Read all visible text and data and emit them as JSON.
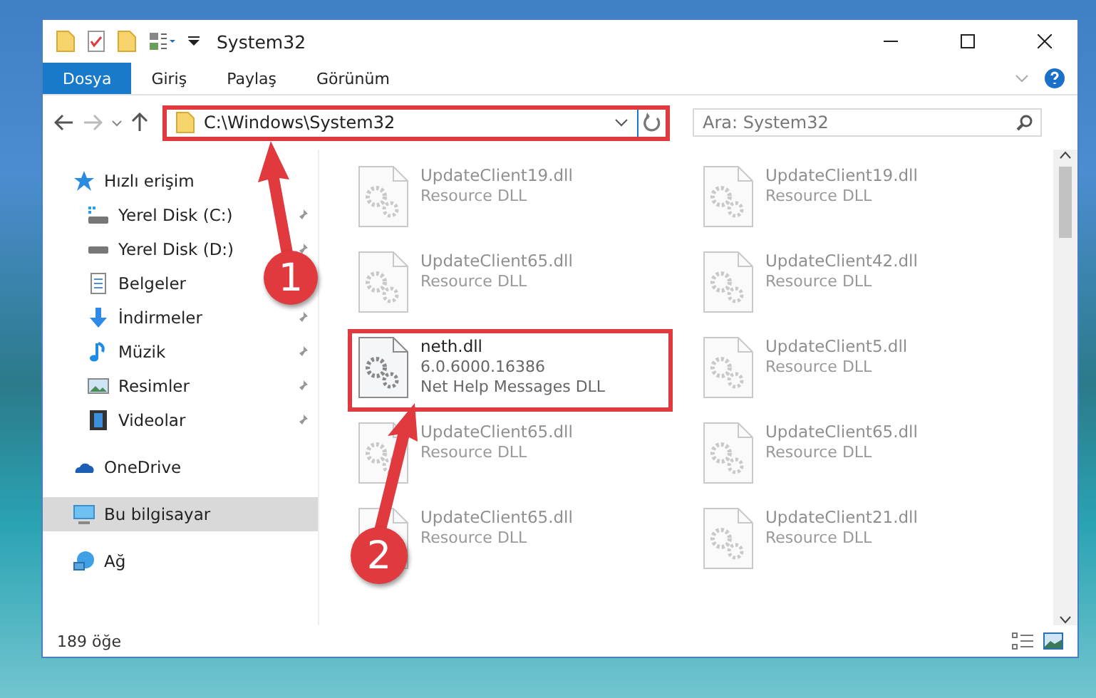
{
  "window": {
    "title": "System32"
  },
  "ribbon_tabs": [
    {
      "label": "Dosya",
      "selected": true
    },
    {
      "label": "Giriş",
      "selected": false
    },
    {
      "label": "Paylaş",
      "selected": false
    },
    {
      "label": "Görünüm",
      "selected": false
    }
  ],
  "address": {
    "path": "C:\\Windows\\System32",
    "highlighted": true
  },
  "search": {
    "placeholder": "Ara: System32"
  },
  "sidebar": {
    "items": [
      {
        "label": "Hızlı erişim",
        "kind": "quick",
        "selected": false,
        "pinned": false,
        "children": [
          {
            "label": "Yerel Disk (C:)",
            "kind": "sysdrive",
            "selected": false,
            "pinned": true
          },
          {
            "label": "Yerel Disk (D:)",
            "kind": "drive",
            "selected": false,
            "pinned": true
          },
          {
            "label": "Belgeler",
            "kind": "docs",
            "selected": false
          },
          {
            "label": "İndirmeler",
            "kind": "download",
            "selected": false,
            "pinned": true
          },
          {
            "label": "Müzik",
            "kind": "music",
            "selected": false,
            "pinned": true
          },
          {
            "label": "Resimler",
            "kind": "pictures",
            "selected": false,
            "pinned": true
          },
          {
            "label": "Videolar",
            "kind": "videos",
            "selected": false,
            "pinned": true
          }
        ]
      },
      {
        "label": "OneDrive",
        "kind": "cloud",
        "selected": false,
        "pinned": false
      },
      {
        "label": "Bu bilgisayar",
        "kind": "pc",
        "selected": true,
        "pinned": false
      },
      {
        "label": "Ağ",
        "kind": "network",
        "selected": false,
        "pinned": false
      }
    ]
  },
  "files": [
    {
      "name": "UpdateClient19.dll",
      "details": [
        "Resource DLL"
      ],
      "blurred": true,
      "highlighted": false
    },
    {
      "name": "UpdateClient19.dll",
      "details": [
        "Resource DLL"
      ],
      "blurred": true,
      "highlighted": false
    },
    {
      "name": "UpdateClient65.dll",
      "details": [
        "Resource DLL"
      ],
      "blurred": true,
      "highlighted": false
    },
    {
      "name": "UpdateClient42.dll",
      "details": [
        "Resource DLL"
      ],
      "blurred": true,
      "highlighted": false
    },
    {
      "name": "neth.dll",
      "details": [
        "6.0.6000.16386",
        "Net Help Messages DLL"
      ],
      "blurred": false,
      "highlighted": true
    },
    {
      "name": "UpdateClient5.dll",
      "details": [
        "Resource DLL"
      ],
      "blurred": true,
      "highlighted": false
    },
    {
      "name": "UpdateClient65.dll",
      "details": [
        "Resource DLL"
      ],
      "blurred": true,
      "highlighted": false
    },
    {
      "name": "UpdateClient65.dll",
      "details": [
        "Resource DLL"
      ],
      "blurred": true,
      "highlighted": false
    },
    {
      "name": "UpdateClient65.dll",
      "details": [
        "Resource DLL"
      ],
      "blurred": true,
      "highlighted": false
    },
    {
      "name": "UpdateClient21.dll",
      "details": [
        "Resource DLL"
      ],
      "blurred": true,
      "highlighted": false
    }
  ],
  "status_bar": {
    "count": "189 öğe"
  },
  "callouts": [
    {
      "number": "1"
    },
    {
      "number": "2"
    }
  ]
}
